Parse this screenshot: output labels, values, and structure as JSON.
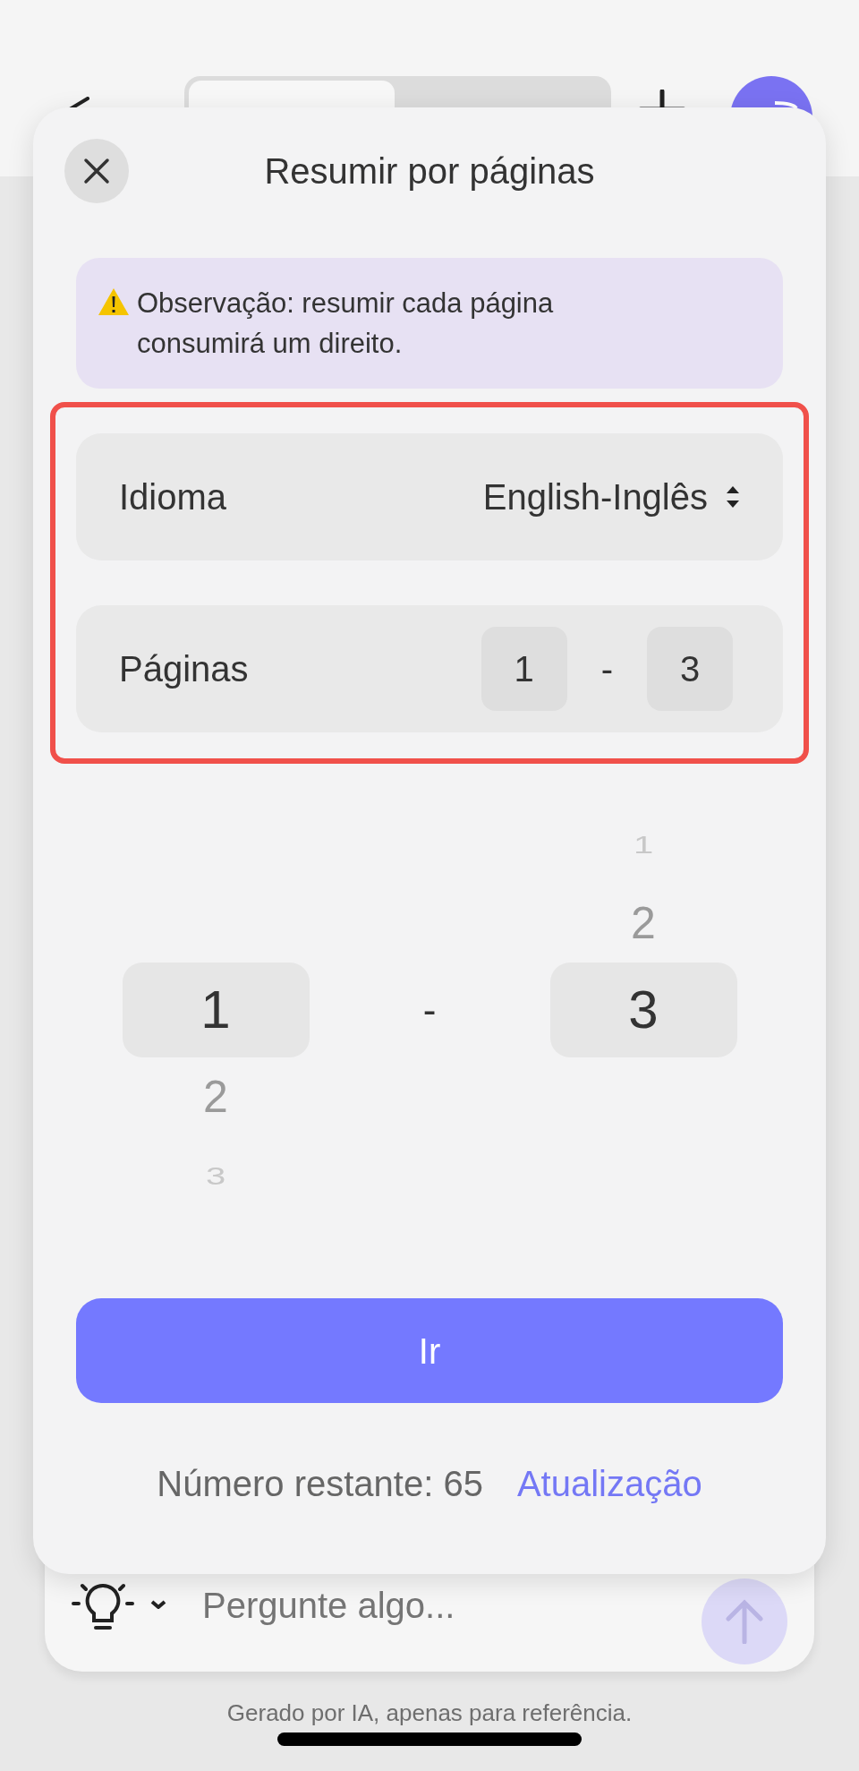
{
  "dialog": {
    "title": "Resumir por páginas",
    "notice": "Observação: resumir cada página consumirá um direito.",
    "language": {
      "label": "Idioma",
      "value": "English-Inglês"
    },
    "pages": {
      "label": "Páginas",
      "from": "1",
      "separator": "-",
      "to": "3"
    },
    "picker": {
      "separator": "-",
      "columns": [
        {
          "items": [
            {
              "label": "1",
              "selected": true
            },
            {
              "label": "2",
              "selected": false
            },
            {
              "label": "3",
              "selected": false
            }
          ]
        },
        {
          "items": [
            {
              "label": "1",
              "selected": false
            },
            {
              "label": "2",
              "selected": false
            },
            {
              "label": "3",
              "selected": true
            }
          ]
        }
      ]
    },
    "go_button": "Ir",
    "remaining": "Número restante: 65",
    "upgrade_link": "Atualização"
  },
  "composer": {
    "placeholder": "Pergunte algo..."
  },
  "disclaimer": "Gerado por IA, apenas para referência."
}
